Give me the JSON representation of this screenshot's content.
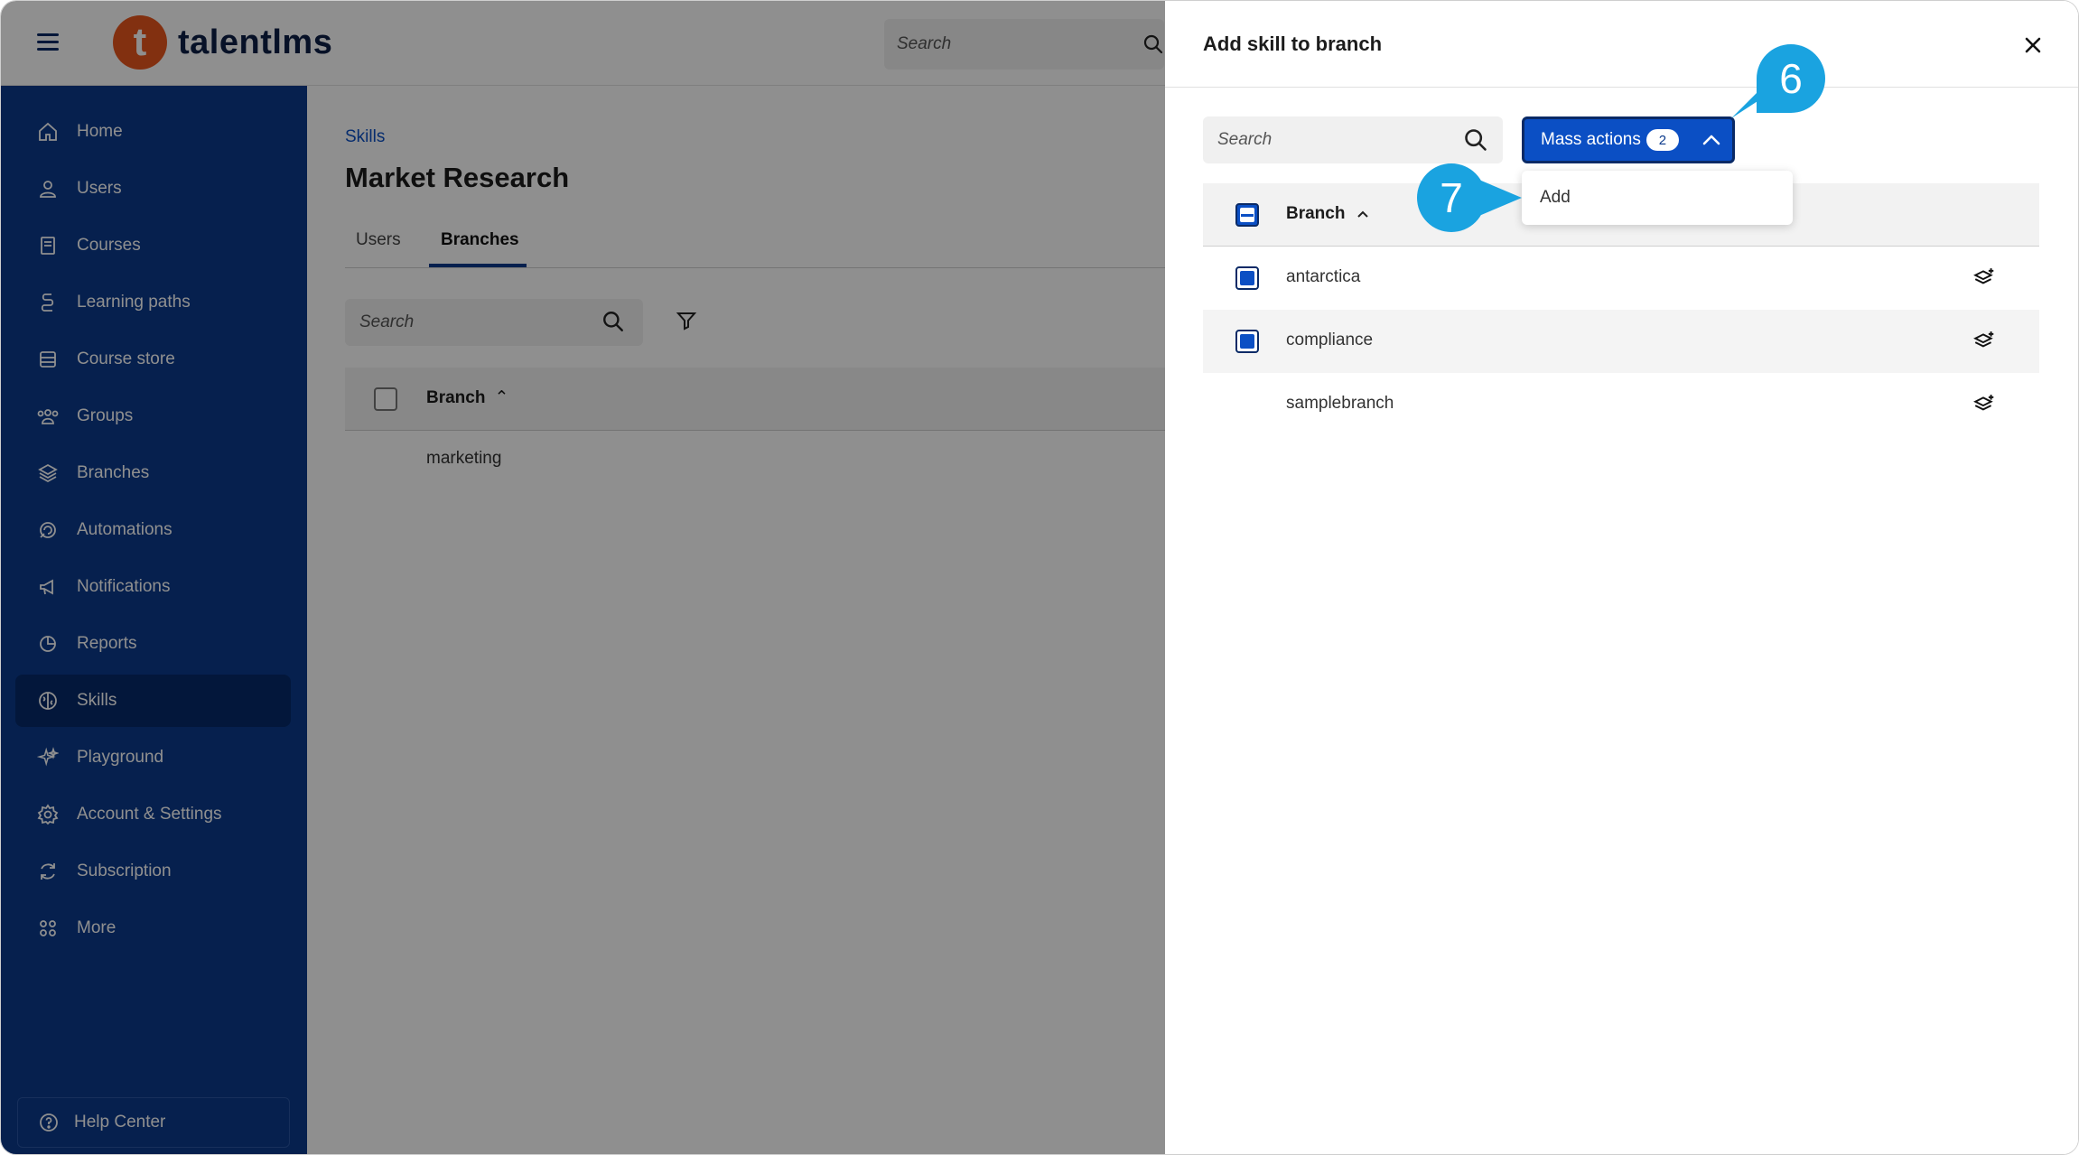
{
  "app": {
    "logo_letter": "t",
    "logo_text": "talentlms",
    "top_search_placeholder": "Search"
  },
  "sidebar": {
    "items": [
      {
        "label": "Home",
        "icon": "home-icon"
      },
      {
        "label": "Users",
        "icon": "user-icon"
      },
      {
        "label": "Courses",
        "icon": "book-icon"
      },
      {
        "label": "Learning paths",
        "icon": "path-icon"
      },
      {
        "label": "Course store",
        "icon": "store-icon"
      },
      {
        "label": "Groups",
        "icon": "groups-icon"
      },
      {
        "label": "Branches",
        "icon": "layers-icon"
      },
      {
        "label": "Automations",
        "icon": "automation-icon"
      },
      {
        "label": "Notifications",
        "icon": "megaphone-icon"
      },
      {
        "label": "Reports",
        "icon": "pie-chart-icon"
      },
      {
        "label": "Skills",
        "icon": "brain-icon",
        "active": true
      },
      {
        "label": "Playground",
        "icon": "sparkle-icon"
      },
      {
        "label": "Account & Settings",
        "icon": "gear-icon"
      },
      {
        "label": "Subscription",
        "icon": "refresh-icon"
      },
      {
        "label": "More",
        "icon": "grid-icon"
      }
    ],
    "help_label": "Help Center"
  },
  "main": {
    "breadcrumb": "Skills",
    "title": "Market Research",
    "tabs": [
      "Users",
      "Branches"
    ],
    "search_placeholder": "Search",
    "table_header": "Branch",
    "rows": [
      "marketing"
    ]
  },
  "drawer": {
    "title": "Add skill to branch",
    "search_placeholder": "Search",
    "mass_actions_label": "Mass actions",
    "mass_actions_count": "2",
    "dropdown_items": [
      "Add"
    ],
    "table_header": "Branch",
    "rows": [
      {
        "name": "antarctica",
        "checked": true
      },
      {
        "name": "compliance",
        "checked": true
      },
      {
        "name": "samplebranch",
        "checked": false
      }
    ]
  },
  "callouts": {
    "step_6": "6",
    "step_7": "7"
  },
  "colors": {
    "sidebar": "#0b3a8c",
    "accent": "#0b4fc4",
    "brand_orange": "#e8571d",
    "callout": "#1aa3e0"
  }
}
